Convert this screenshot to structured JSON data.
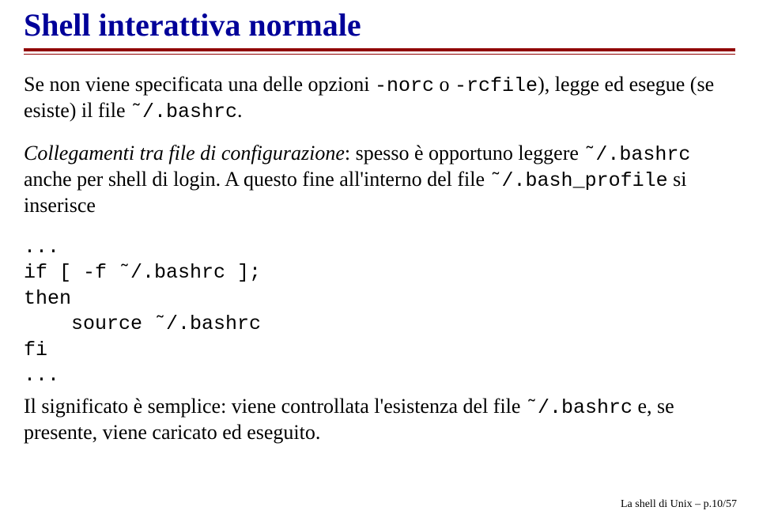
{
  "title": "Shell interattiva normale",
  "para1": {
    "t1": "Se non viene specificata una delle opzioni ",
    "c1": "-norc",
    "t2": " o ",
    "c2": "-rcfile",
    "t3": "), legge ed esegue (se esiste) il file ",
    "c3": "˜/.bashrc",
    "t4": "."
  },
  "para2": {
    "i1": "Collegamenti tra file di configurazione",
    "t1": ": spesso è opportuno leggere ",
    "c1": "˜/.bashrc",
    "t2": " anche per shell di login. A questo fine all'interno del file ",
    "c2": "˜/.bash_profile",
    "t3": " si inserisce"
  },
  "code": "...\nif [ -f ˜/.bashrc ];\nthen\n    source ˜/.bashrc\nfi\n...",
  "para3": {
    "t1": "Il significato è semplice: viene controllata l'esistenza del file ",
    "c1": "˜/.bashrc",
    "t2": " e, se presente, viene caricato ed eseguito."
  },
  "footer": "La shell di Unix – p.10/57"
}
